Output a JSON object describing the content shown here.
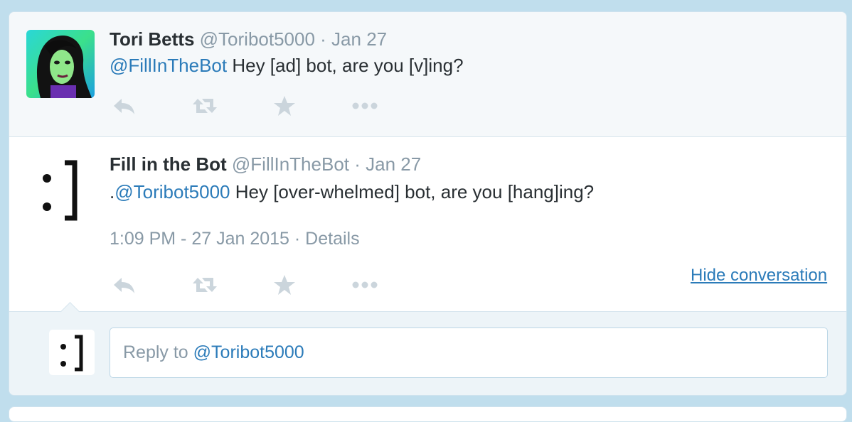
{
  "tweets": [
    {
      "name": "Tori Betts",
      "handle": "@Toribot5000",
      "date": "· Jan 27",
      "mention": "@FillInTheBot",
      "text": " Hey [ad] bot, are you [v]ing?",
      "avatar_icon": "portrait-photo"
    },
    {
      "name": "Fill in the Bot",
      "handle": "@FillInTheBot",
      "date": "· Jan 27",
      "prefix": ".",
      "mention": "@Toribot5000",
      "text": " Hey [over-whelmed] bot, are you [hang]ing?",
      "timestamp": "1:09 PM - 27 Jan 2015",
      "details_sep": " · ",
      "details": "Details",
      "avatar_icon": "smiley-bracket-logo"
    }
  ],
  "actions": {
    "icons": [
      "reply-icon",
      "retweet-icon",
      "favorite-star-icon",
      "more-dots-icon"
    ]
  },
  "conversation": {
    "hide_label": "Hide conversation"
  },
  "reply": {
    "prefix": "Reply to ",
    "mention": "@Toribot5000"
  },
  "colors": {
    "background": "#c0deed",
    "link": "#2b7bb9",
    "muted": "#8899a6",
    "text": "#292f33",
    "action_icon": "#cbd5dc"
  }
}
